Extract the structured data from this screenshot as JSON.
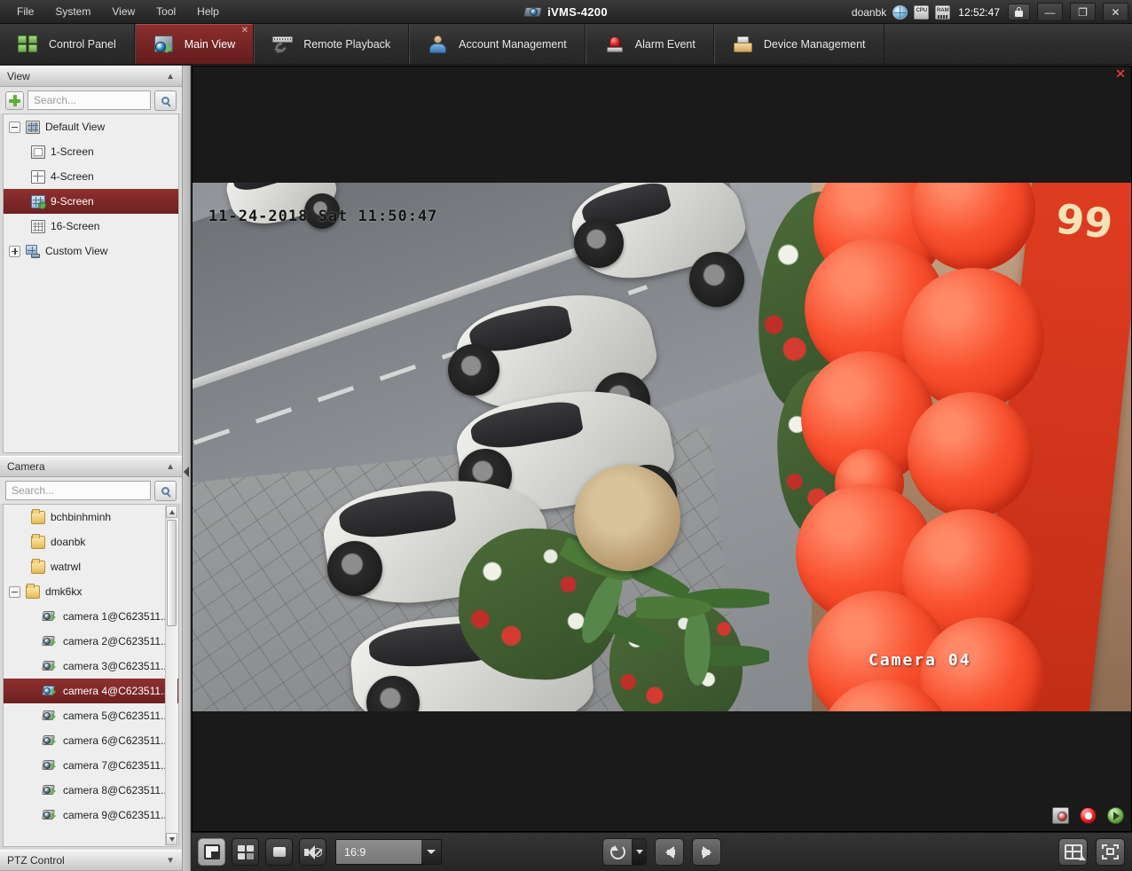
{
  "titlebar": {
    "app_title": "iVMS-4200",
    "app_icon": "camera-icon",
    "user": "doanbk",
    "clock": "12:52:47",
    "cpu_label": "CPU",
    "ram_label": "RAM",
    "globe_icon": "globe-icon",
    "lock_icon": "lock-icon",
    "minimize_label": "—",
    "maximize_label": "❐",
    "close_label": "✕",
    "menus": [
      {
        "label": "File"
      },
      {
        "label": "System"
      },
      {
        "label": "View"
      },
      {
        "label": "Tool"
      },
      {
        "label": "Help"
      }
    ]
  },
  "tabs": [
    {
      "label": "Control Panel",
      "icon": "control-panel-icon",
      "active": false,
      "closable": false
    },
    {
      "label": "Main View",
      "icon": "main-view-icon",
      "active": true,
      "closable": true,
      "close_label": "✕"
    },
    {
      "label": "Remote Playback",
      "icon": "remote-playback-icon",
      "active": false,
      "closable": false
    },
    {
      "label": "Account Management",
      "icon": "account-management-icon",
      "active": false,
      "closable": false
    },
    {
      "label": "Alarm Event",
      "icon": "alarm-event-icon",
      "active": false,
      "closable": false
    },
    {
      "label": "Device Management",
      "icon": "device-management-icon",
      "active": false,
      "closable": false
    }
  ],
  "view_panel": {
    "title": "View",
    "collapse_icon": "chevron-up-icon",
    "add_button_icon": "plus-icon",
    "search_placeholder": "Search...",
    "search_value": "",
    "search_button_icon": "search-icon",
    "tree": [
      {
        "label": "Default View",
        "icon": "grid-view-icon",
        "level": 0,
        "expander": "minus",
        "selected": false
      },
      {
        "label": "1-Screen",
        "icon": "screen-1-icon",
        "level": 1,
        "expander": "none",
        "selected": false
      },
      {
        "label": "4-Screen",
        "icon": "screen-4-icon",
        "level": 1,
        "expander": "none",
        "selected": false
      },
      {
        "label": "9-Screen",
        "icon": "screen-9-icon",
        "level": 1,
        "expander": "none",
        "selected": true
      },
      {
        "label": "16-Screen",
        "icon": "screen-16-icon",
        "level": 1,
        "expander": "none",
        "selected": false
      },
      {
        "label": "Custom View",
        "icon": "custom-view-icon",
        "level": 0,
        "expander": "plus",
        "selected": false
      }
    ]
  },
  "camera_panel": {
    "title": "Camera",
    "collapse_icon": "chevron-up-icon",
    "search_placeholder": "Search...",
    "search_value": "",
    "search_button_icon": "search-icon",
    "tree": [
      {
        "label": "bchbinhminh",
        "icon": "folder-icon",
        "level": 0,
        "expander": "none",
        "selected": false
      },
      {
        "label": "doanbk",
        "icon": "folder-icon",
        "level": 0,
        "expander": "none",
        "selected": false
      },
      {
        "label": "watrwl",
        "icon": "folder-icon",
        "level": 0,
        "expander": "none",
        "selected": false
      },
      {
        "label": "dmk6kx",
        "icon": "folder-icon",
        "level": 0,
        "expander": "minus",
        "selected": false
      },
      {
        "label": "camera 1@C623511...",
        "icon": "camera-icon",
        "level": 1,
        "expander": "none",
        "selected": false
      },
      {
        "label": "camera 2@C623511...",
        "icon": "camera-icon",
        "level": 1,
        "expander": "none",
        "selected": false
      },
      {
        "label": "camera 3@C623511...",
        "icon": "camera-icon",
        "level": 1,
        "expander": "none",
        "selected": false
      },
      {
        "label": "camera 4@C623511...",
        "icon": "camera-icon",
        "level": 1,
        "expander": "none",
        "selected": true
      },
      {
        "label": "camera 5@C623511...",
        "icon": "camera-icon",
        "level": 1,
        "expander": "none",
        "selected": false
      },
      {
        "label": "camera 6@C623511...",
        "icon": "camera-icon",
        "level": 1,
        "expander": "none",
        "selected": false
      },
      {
        "label": "camera 7@C623511...",
        "icon": "camera-icon",
        "level": 1,
        "expander": "none",
        "selected": false
      },
      {
        "label": "camera 8@C623511...",
        "icon": "camera-icon",
        "level": 1,
        "expander": "none",
        "selected": false
      },
      {
        "label": "camera 9@C623511...",
        "icon": "camera-icon",
        "level": 1,
        "expander": "none",
        "selected": false
      }
    ]
  },
  "ptz_panel": {
    "title": "PTZ Control",
    "expand_icon": "chevron-down-icon"
  },
  "video": {
    "close_label": "✕",
    "osd_timestamp": "11-24-2018 Sat 11:50:47",
    "camera_label": "Camera 04",
    "banner_text": "99",
    "overlay_tools": [
      {
        "icon": "snapshot-icon",
        "name": "capture-button"
      },
      {
        "icon": "record-icon",
        "name": "record-button"
      },
      {
        "icon": "instant-playback-icon",
        "name": "instant-playback-button"
      }
    ]
  },
  "bottom_toolbar": {
    "save_view_icon": "save-view-icon",
    "window_division_icon": "window-division-icon",
    "stop_all_icon": "stop-icon",
    "mute_icon": "mute-speaker-icon",
    "ratio_value": "16:9",
    "ratio_arrow_icon": "chevron-down-icon",
    "refresh_icon": "refresh-icon",
    "refresh_dropdown_icon": "chevron-down-icon",
    "previous_icon": "arrow-left-icon",
    "next_icon": "arrow-right-icon",
    "layout_icon": "layout-grid-icon",
    "fullscreen_icon": "fullscreen-icon"
  },
  "colors": {
    "accent_red": "#7a2626",
    "selection_red": "#8f3030",
    "panel_gray": "#d8d8d8",
    "toolbar_dark": "#2d2d2d"
  }
}
